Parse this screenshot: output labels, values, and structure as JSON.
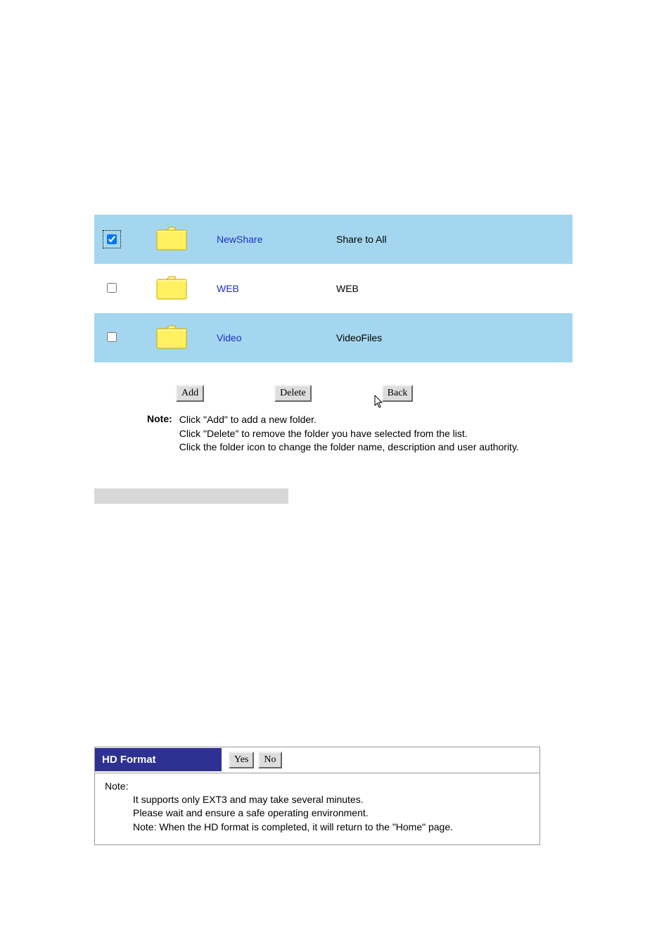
{
  "folders": [
    {
      "checked": true,
      "highlight": true,
      "dotted": true,
      "name": "NewShare",
      "desc": "Share to All"
    },
    {
      "checked": false,
      "highlight": false,
      "dotted": false,
      "name": "WEB",
      "desc": "WEB"
    },
    {
      "checked": false,
      "highlight": true,
      "dotted": false,
      "name": "Video",
      "desc": "VideoFiles"
    }
  ],
  "buttons": {
    "add": "Add",
    "delete": "Delete",
    "back": "Back"
  },
  "note": {
    "label": "Note:",
    "line1": "Click \"Add\" to add a new folder.",
    "line2": "Click \"Delete\" to remove the folder you have selected from the list.",
    "line3": "Click the folder icon to change the folder name, description and user authority."
  },
  "hd": {
    "title": "HD Format",
    "yes": "Yes",
    "no": "No",
    "noteLabel": "Note:",
    "line1": "It supports only EXT3 and may take several minutes.",
    "line2": "Please wait and ensure a safe operating environment.",
    "line3": "Note: When the HD format is completed, it will return to the \"Home\" page."
  }
}
